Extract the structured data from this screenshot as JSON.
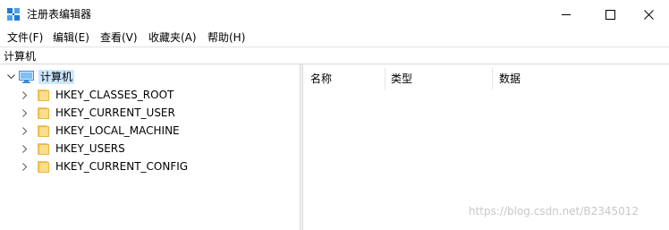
{
  "window": {
    "title": "注册表编辑器",
    "controls": [
      "minimize-icon",
      "maximize-icon",
      "close-icon"
    ]
  },
  "menu": [
    "文件(F)",
    "编辑(E)",
    "查看(V)",
    "收藏夹(A)",
    "帮助(H)"
  ],
  "address": "计算机",
  "tree": {
    "root": {
      "label": "计算机",
      "icon": "computer-icon",
      "expanded": true
    },
    "hives": [
      {
        "label": "HKEY_CLASSES_ROOT",
        "icon": "folder-icon"
      },
      {
        "label": "HKEY_CURRENT_USER",
        "icon": "folder-icon"
      },
      {
        "label": "HKEY_LOCAL_MACHINE",
        "icon": "folder-icon"
      },
      {
        "label": "HKEY_USERS",
        "icon": "folder-icon"
      },
      {
        "label": "HKEY_CURRENT_CONFIG",
        "icon": "folder-icon"
      }
    ]
  },
  "list": {
    "columns": [
      "名称",
      "类型",
      "数据"
    ]
  },
  "watermark": "https://blog.csdn.net/B2345012",
  "colors": {
    "selection": "#cce8ff",
    "folder": "#fbdd8a",
    "app_icon": "#1f7ad6"
  }
}
